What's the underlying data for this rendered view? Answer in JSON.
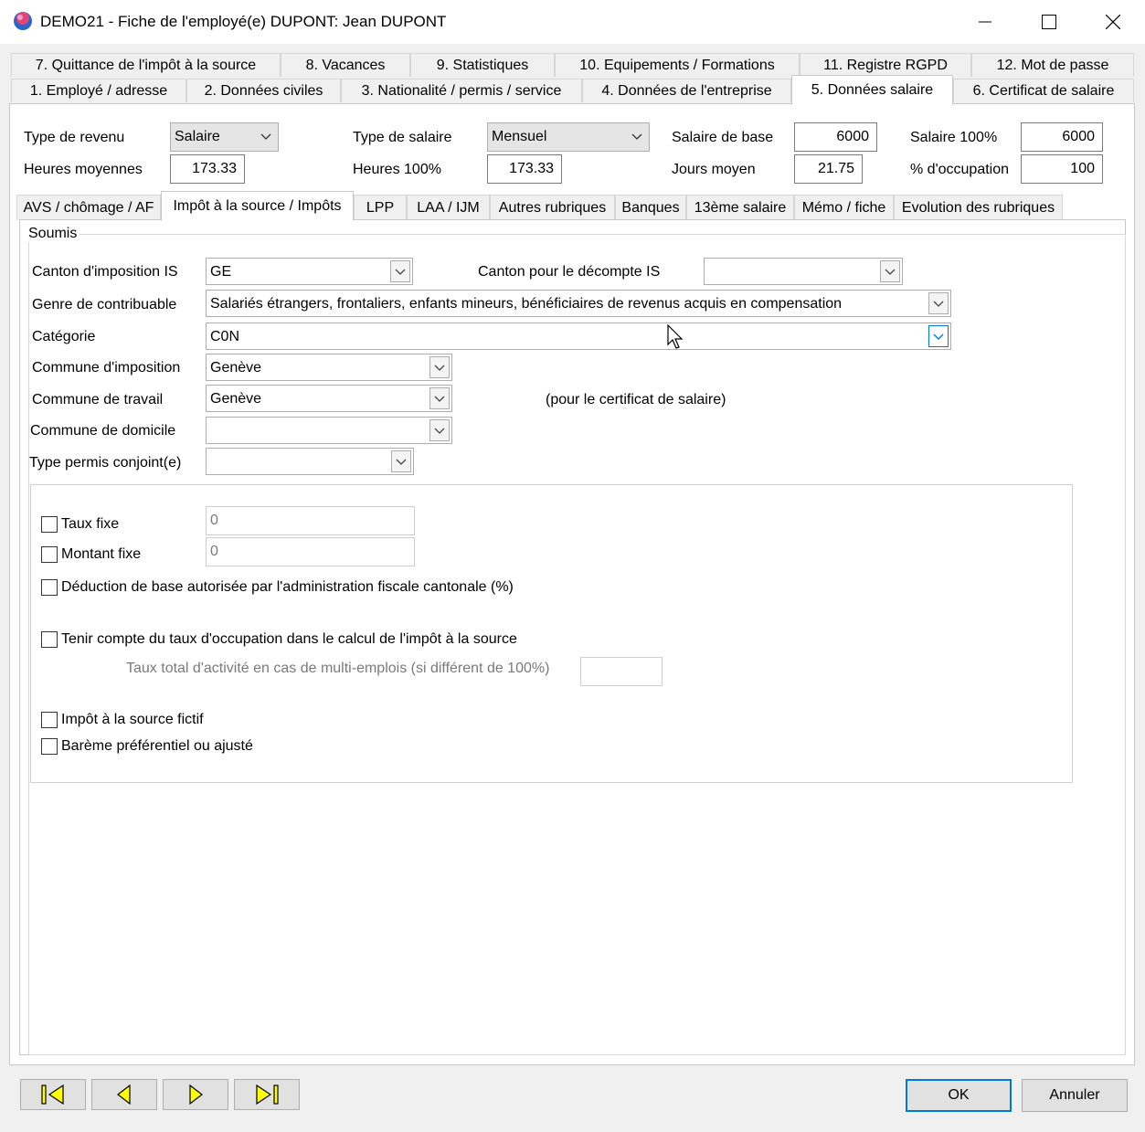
{
  "window": {
    "title": "DEMO21 - Fiche de l'employé(e) DUPONT:  Jean DUPONT",
    "icon": "app-logo-icon",
    "controls": [
      "minimize-icon",
      "maximize-icon",
      "close-icon"
    ]
  },
  "main_tabs_row1": [
    {
      "label": "7. Quittance de l'impôt à la source"
    },
    {
      "label": "8. Vacances"
    },
    {
      "label": "9. Statistiques"
    },
    {
      "label": "10. Equipements / Formations"
    },
    {
      "label": "11. Registre RGPD"
    },
    {
      "label": "12. Mot de passe"
    }
  ],
  "main_tabs_row2": [
    {
      "label": "1. Employé / adresse"
    },
    {
      "label": "2. Données civiles"
    },
    {
      "label": "3. Nationalité / permis / service"
    },
    {
      "label": "4. Données de l'entreprise"
    },
    {
      "label": "5. Données salaire",
      "active": true
    },
    {
      "label": "6. Certificat de salaire"
    }
  ],
  "header": {
    "type_revenu_label": "Type de revenu",
    "type_revenu_value": "Salaire",
    "heures_moyennes_label": "Heures moyennes",
    "heures_moyennes_value": "173.33",
    "type_salaire_label": "Type de salaire",
    "type_salaire_value": "Mensuel",
    "heures_100_label": "Heures 100%",
    "heures_100_value": "173.33",
    "salaire_base_label": "Salaire de base",
    "salaire_base_value": "6000",
    "jours_moyen_label": "Jours moyen",
    "jours_moyen_value": "21.75",
    "salaire_100_label": "Salaire 100%",
    "salaire_100_value": "6000",
    "occupation_label": "% d'occupation",
    "occupation_value": "100"
  },
  "sub_tabs": [
    {
      "label": "AVS / chômage / AF"
    },
    {
      "label": "Impôt à la source / Impôts",
      "active": true
    },
    {
      "label": "LPP"
    },
    {
      "label": "LAA / IJM"
    },
    {
      "label": "Autres rubriques"
    },
    {
      "label": "Banques"
    },
    {
      "label": "13ème salaire"
    },
    {
      "label": "Mémo / fiche"
    },
    {
      "label": "Evolution des rubriques"
    }
  ],
  "form": {
    "group_title": "Soumis",
    "canton_is_label": "Canton d'imposition IS",
    "canton_is_value": "GE",
    "canton_decompte_label": "Canton pour le décompte IS",
    "canton_decompte_value": "",
    "genre_label": "Genre de contribuable",
    "genre_value": "Salariés étrangers, frontaliers, enfants mineurs, bénéficiaires de revenus acquis en compensation",
    "categorie_label": "Catégorie",
    "categorie_value": "C0N",
    "commune_imposition_label": "Commune d'imposition",
    "commune_imposition_value": "Genève",
    "commune_travail_label": "Commune de travail",
    "commune_travail_value": "Genève",
    "commune_travail_note": "(pour le certificat de salaire)",
    "commune_domicile_label": "Commune de domicile",
    "commune_domicile_value": "",
    "permis_conjoint_label": "Type permis conjoint(e)",
    "permis_conjoint_value": ""
  },
  "options": {
    "taux_fixe_label": "Taux fixe",
    "taux_fixe_value": "0",
    "montant_fixe_label": "Montant fixe",
    "montant_fixe_value": "0",
    "deduction_label": "Déduction de base autorisée par l'administration fiscale cantonale (%)",
    "tenir_compte_label": "Tenir compte du taux d'occupation dans le calcul de l'impôt à la source",
    "taux_total_label": "Taux total d'activité en cas de multi-emplois (si différent de 100%)",
    "taux_total_value": "",
    "impot_fictif_label": "Impôt à la source fictif",
    "bareme_label": "Barème préférentiel ou ajusté"
  },
  "footer": {
    "nav_icons": [
      "first-record-icon",
      "previous-record-icon",
      "next-record-icon",
      "last-record-icon"
    ],
    "ok_label": "OK",
    "cancel_label": "Annuler"
  },
  "colors": {
    "nav_yellow": "#ffff00",
    "focus_blue": "#0078d7",
    "window_bg": "#f0f0f0"
  }
}
